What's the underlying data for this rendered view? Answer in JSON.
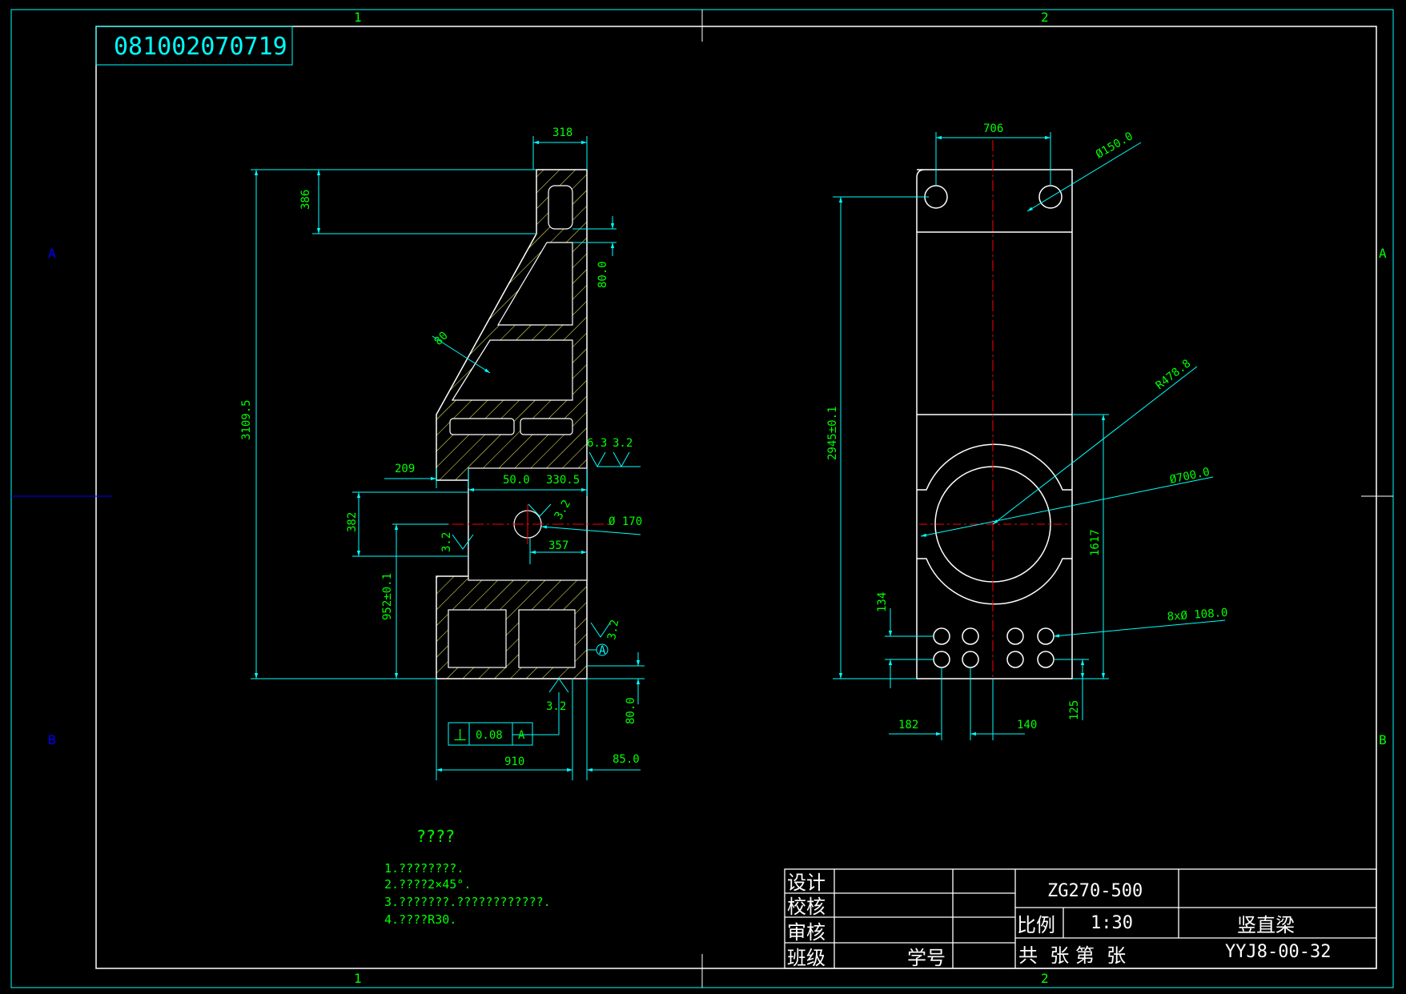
{
  "colors": {
    "background": "#000000",
    "geometry": "#ffffff",
    "dimension": "#00ffff",
    "dim_text": "#00ff00",
    "centerline": "#ff0000",
    "zone_label": "#0000ff"
  },
  "sheet": {
    "drawing_no_box": "081002070719",
    "zone_top": [
      "1",
      "2"
    ],
    "zone_bottom": [
      "1",
      "2"
    ],
    "zone_left": [
      "A",
      "B"
    ],
    "zone_right": [
      "A",
      "B"
    ]
  },
  "side_view": {
    "dims": {
      "top_width": "318",
      "top_pocket": "386",
      "total_height": "3109.5",
      "wall_80_top": "80.0",
      "chamfer_80": "80",
      "w209": "209",
      "w50": "50.0",
      "w330": "330.5",
      "h382": "382",
      "w357": "357",
      "hole170": "Ø 170",
      "h952": "952±0.1",
      "wall_80_bottom": "80.0",
      "base_910": "910",
      "side_85": "85.0"
    },
    "roughness": [
      "6.3",
      "3.2",
      "3.2",
      "3.2",
      "3.2",
      "3.2"
    ],
    "datum": "A",
    "tolerance_frame": {
      "symbol": "⊥",
      "value": "0.08",
      "datum": "A"
    }
  },
  "front_view": {
    "dims": {
      "w706": "706",
      "d150": "Ø150.0",
      "h2945": "2945±0.1",
      "r478": "R478.8",
      "d700": "Ø700.0",
      "h1617": "1617",
      "h134": "134",
      "holes": "8xØ 108.0",
      "w182": "182",
      "w140": "140",
      "h125": "125"
    }
  },
  "notes": {
    "title": "????",
    "items": [
      "1.????????.",
      "2.????2×45°.",
      "3.???????.????????????.",
      "4.????R30."
    ]
  },
  "title_block": {
    "designer": "设计",
    "checker": "校核",
    "reviewer": "审核",
    "class_label": "班级",
    "student_no": "学号",
    "material": "ZG270-500",
    "scale_label": "比例",
    "scale_value": "1:30",
    "sheets": "共  张 第  张",
    "part_name": "竖直梁",
    "drawing_code": "YYJ8-00-32"
  }
}
